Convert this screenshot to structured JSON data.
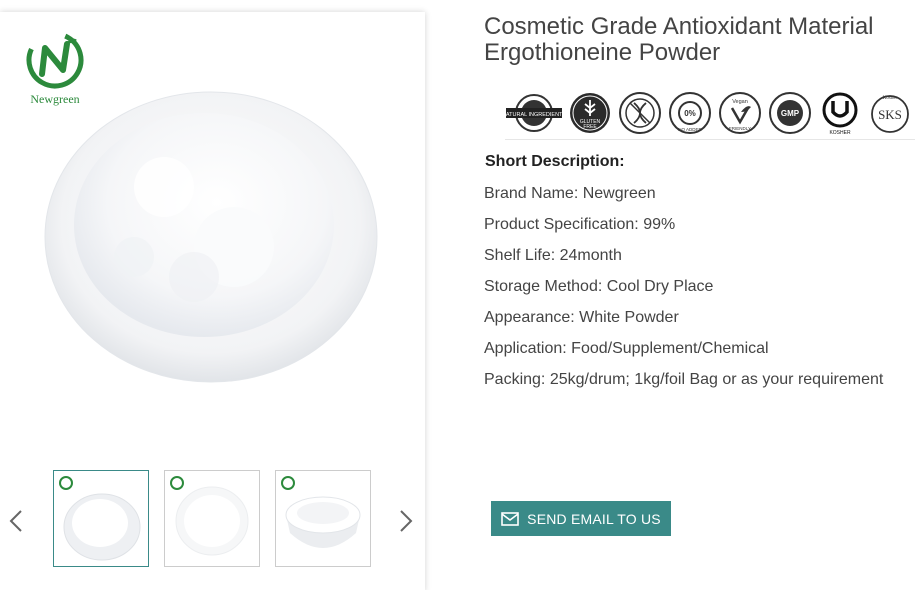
{
  "brand": {
    "logo_text": "Newgreen",
    "primary_color": "#2c8a3c",
    "accent_color": "#3a8a88"
  },
  "product": {
    "title_line1": "Cosmetic Grade Antioxidant Material",
    "title_line2": "Ergothioneine Powder"
  },
  "certifications": [
    {
      "icon": "natural-ingredients-icon",
      "label": "NATURAL INGREDIENTS"
    },
    {
      "icon": "gluten-free-icon",
      "label": "GLUTEN FREE"
    },
    {
      "icon": "non-gmo-icon",
      "label": "NON GMO"
    },
    {
      "icon": "no-preservatives-icon",
      "label": "0% NO ADDED"
    },
    {
      "icon": "vegan-friendly-icon",
      "label": "Vegan FRIENDLY"
    },
    {
      "icon": "gmp-certified-icon",
      "label": "GMP CERTIFIED"
    },
    {
      "icon": "kosher-u-icon",
      "label": "KOSHER"
    },
    {
      "icon": "kosher-sks-icon",
      "label": "Kosher SKS"
    }
  ],
  "description": {
    "heading": "Short Description:",
    "rows": [
      "Brand Name: Newgreen",
      "Product Specification: 99%",
      "Shelf Life: 24month",
      "Storage Method: Cool Dry Place",
      "Appearance: White Powder",
      "Application: Food/Supplement/Chemical",
      "Packing: 25kg/drum; 1kg/foil Bag or as your requirement"
    ]
  },
  "actions": {
    "send_email_label": "SEND EMAIL TO US"
  },
  "gallery": {
    "thumbnail_count": 3,
    "active_index": 0
  }
}
